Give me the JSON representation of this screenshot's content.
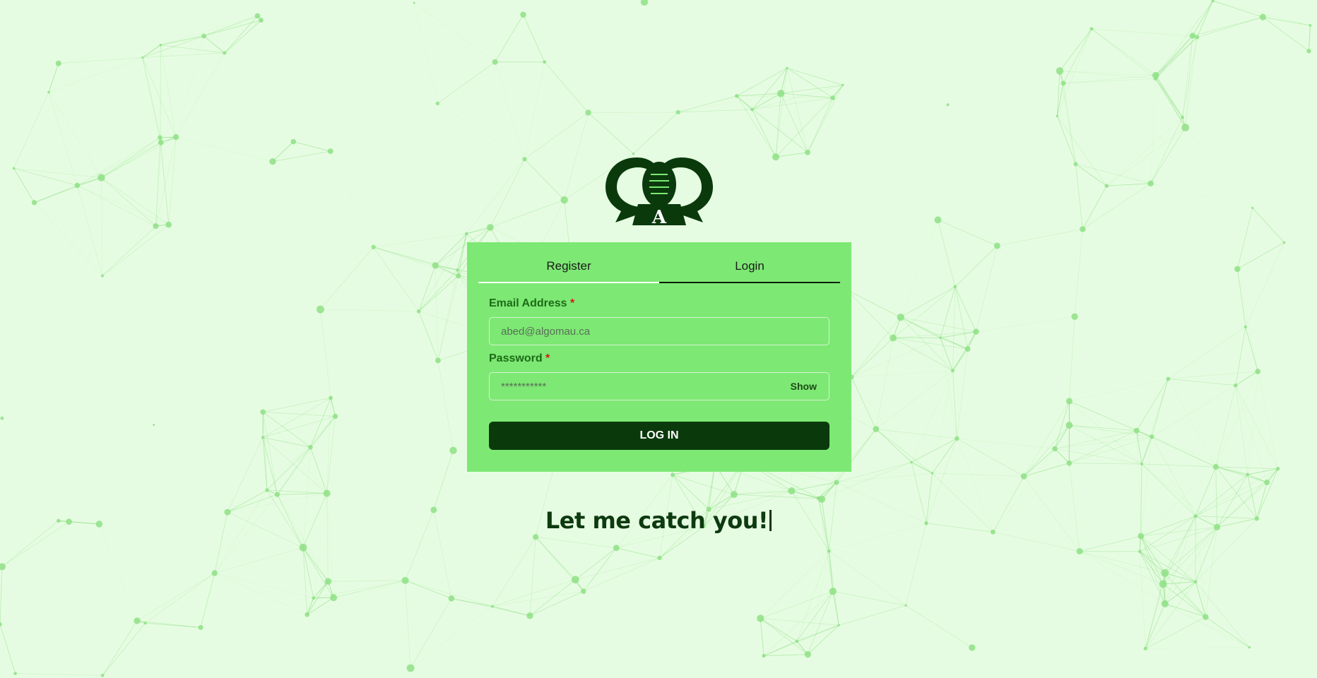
{
  "colors": {
    "background": "#e6fce2",
    "network": "#8fe086",
    "card": "#7de874",
    "primary_dark": "#0a3a0c",
    "label": "#1d6b16",
    "required": "#d91818"
  },
  "logo": {
    "icon": "speech-bubbles-football-logo",
    "letter": "A"
  },
  "tabs": [
    {
      "label": "Register",
      "active": false
    },
    {
      "label": "Login",
      "active": true
    }
  ],
  "form": {
    "email": {
      "label": "Email Address",
      "required_mark": "*",
      "placeholder": "abed@algomau.ca",
      "value": ""
    },
    "password": {
      "label": "Password",
      "required_mark": "*",
      "placeholder": "***********",
      "value": "",
      "toggle_label": "Show"
    },
    "submit_label": "LOG IN"
  },
  "tagline": "Let me catch you!"
}
